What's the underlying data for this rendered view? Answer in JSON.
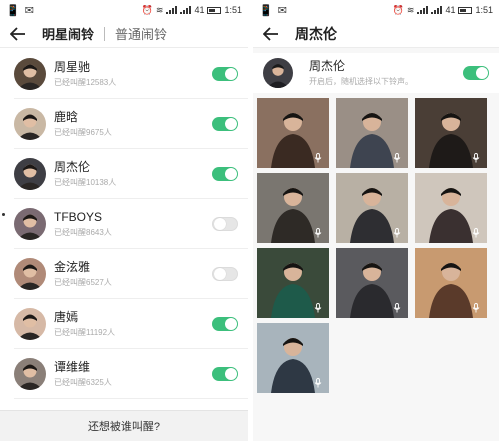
{
  "statusbar": {
    "carrier_left": "IIII",
    "carrier_right": "IIII",
    "battery": "41",
    "time": "1:51"
  },
  "left": {
    "tabs": [
      {
        "label": "明星闹铃"
      },
      {
        "label": "普通闹铃"
      }
    ],
    "stars": [
      {
        "name": "周星驰",
        "count": "已经叫醒12583人",
        "enabled": true,
        "bg": "#5a4a3c"
      },
      {
        "name": "鹿晗",
        "count": "已经叫醒9675人",
        "enabled": true,
        "bg": "#c9b8a4"
      },
      {
        "name": "周杰伦",
        "count": "已经叫醒10138人",
        "enabled": true,
        "bg": "#3e3e44"
      },
      {
        "name": "TFBOYS",
        "count": "已经叫醒8643人",
        "enabled": false,
        "bg": "#7a6a72"
      },
      {
        "name": "金泫雅",
        "count": "已经叫醒6527人",
        "enabled": false,
        "bg": "#b08a78"
      },
      {
        "name": "唐嫣",
        "count": "已经叫醒11192人",
        "enabled": true,
        "bg": "#d6b9a6"
      },
      {
        "name": "谭维维",
        "count": "已经叫醒6325人",
        "enabled": true,
        "bg": "#8a7f78"
      }
    ],
    "bottom_text": "还想被谁叫醒?"
  },
  "right": {
    "title": "周杰伦",
    "artist": {
      "name": "周杰伦",
      "hint": "开启后，随机选择以下铃声。",
      "enabled": true
    },
    "photos": [
      {
        "bg": "#8a7060",
        "fg": "#3a2a22"
      },
      {
        "bg": "#9a8f86",
        "fg": "#3e4450"
      },
      {
        "bg": "#4a3e36",
        "fg": "#1e1a18"
      },
      {
        "bg": "#7a7670",
        "fg": "#2e2a26"
      },
      {
        "bg": "#b8b0a4",
        "fg": "#2e2e32"
      },
      {
        "bg": "#cfc6bc",
        "fg": "#3a3030"
      },
      {
        "bg": "#3a4a3a",
        "fg": "#1e5a4a"
      },
      {
        "bg": "#5a5a5e",
        "fg": "#2a2a2e"
      },
      {
        "bg": "#c89a70",
        "fg": "#5a3a2a"
      },
      {
        "bg": "#a8b4bc",
        "fg": "#2e3844"
      }
    ]
  }
}
